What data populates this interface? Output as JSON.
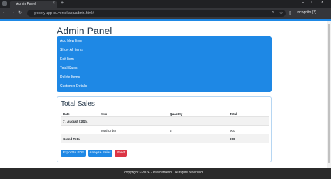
{
  "browser": {
    "tab_title": "Admin Panel",
    "url": "grocery-app-nu.vercel.app/admin.html#",
    "incognito_label": "Incognito (2)"
  },
  "page": {
    "title": "Admin Panel",
    "menu": [
      "Add New Item",
      "Show All Items",
      "Edit Item",
      "Total Sales",
      "Delete Items",
      "Customer Details"
    ]
  },
  "sales": {
    "title": "Total Sales",
    "headers": [
      "Date",
      "Item",
      "Quantity",
      "Total"
    ],
    "date_group": "7 / August / 2024",
    "rows": [
      {
        "item": "Total Order",
        "quantity": "5",
        "total": "900"
      }
    ],
    "grand_total_label": "Grand Total",
    "grand_total_value": "900",
    "buttons": {
      "export": "Export to PDF",
      "analyse": "Analyse Sales",
      "reset": "Reset"
    }
  },
  "footer": {
    "text": "copyright ©2024 - Prathamesh . All rights reserved"
  },
  "colors": {
    "primary": "#1e88e5",
    "reset": "#dc3545",
    "title": "#2c3e50",
    "footer": "#2b2b2b"
  }
}
